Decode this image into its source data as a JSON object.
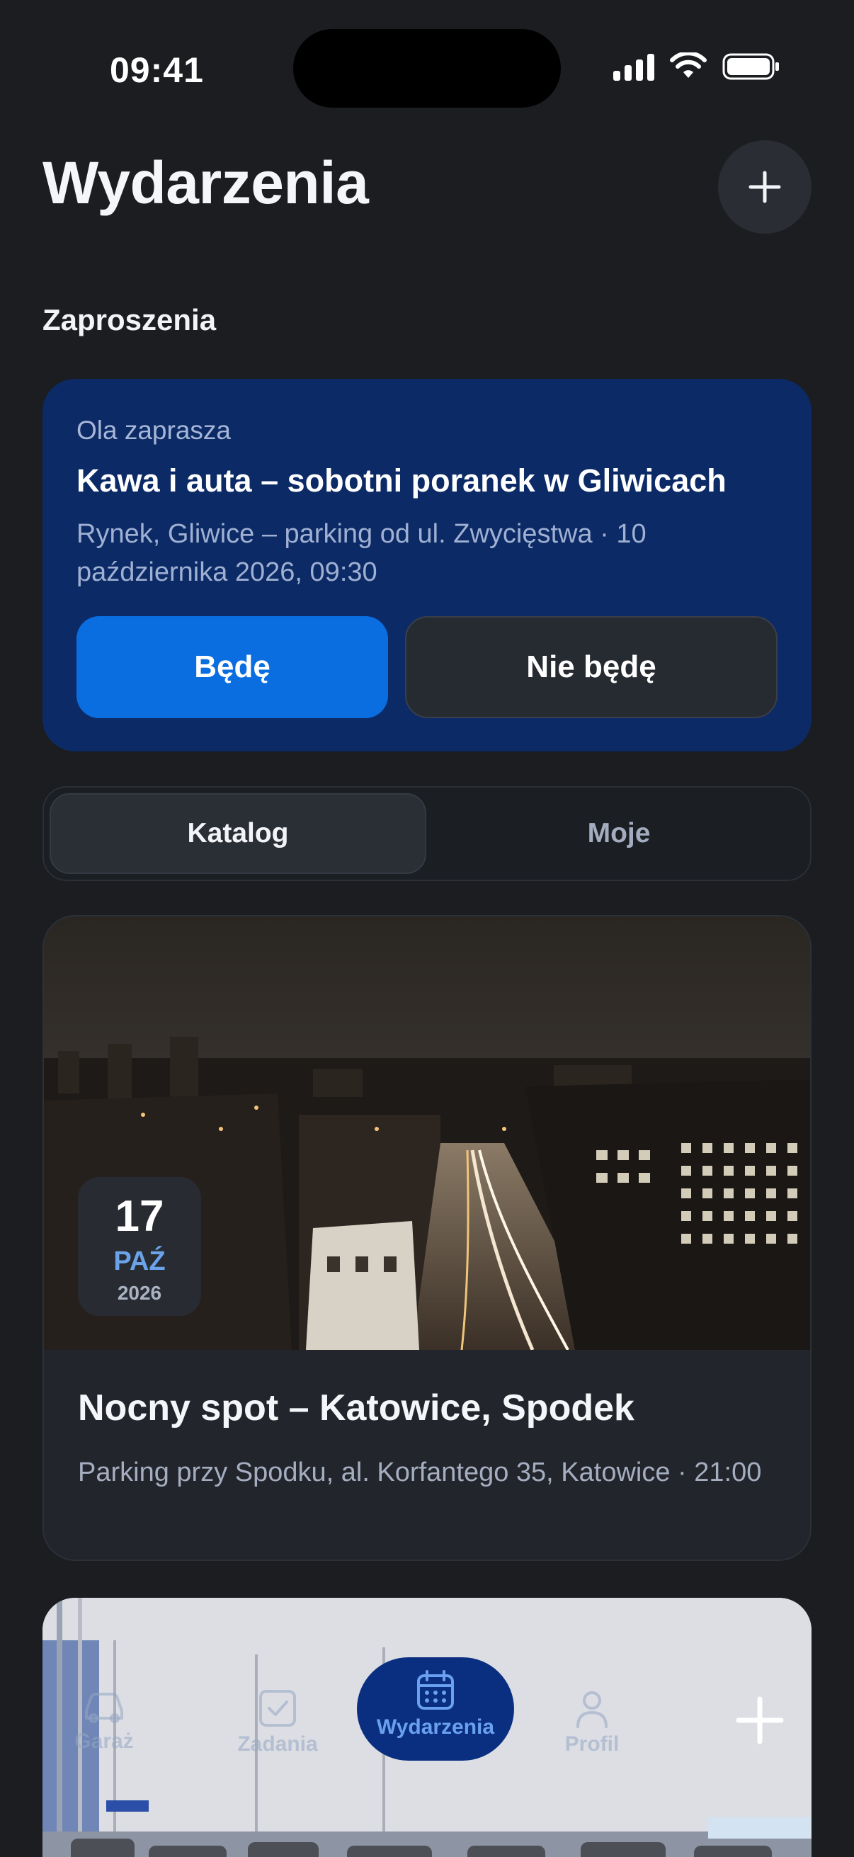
{
  "status_bar": {
    "time": "09:41"
  },
  "header": {
    "title": "Wydarzenia"
  },
  "invitations": {
    "section_title": "Zaproszenia",
    "card": {
      "from": "Ola zaprasza",
      "title": "Kawa i auta – sobotni poranek w Gliwicach",
      "meta": "Rynek, Gliwice – parking od ul. Zwycięstwa · 10 października 2026, 09:30",
      "accept_label": "Będę",
      "decline_label": "Nie będę"
    }
  },
  "segment": {
    "tabs": [
      "Katalog",
      "Moje"
    ],
    "selected": "Katalog"
  },
  "events": [
    {
      "day": "17",
      "month": "PAŹ",
      "year": "2026",
      "title": "Nocny spot – Katowice, Spodek",
      "meta": "Parking przy Spodku, al. Korfantego 35, Katowice · 21:00"
    }
  ],
  "tabbar": {
    "items": [
      {
        "label": "Garaż",
        "icon": "car-icon"
      },
      {
        "label": "Zadania",
        "icon": "checkbox-icon"
      },
      {
        "label": "Wydarzenia",
        "icon": "calendar-icon",
        "active": true
      },
      {
        "label": "Profil",
        "icon": "person-icon"
      }
    ],
    "plus_icon": "plus-icon"
  },
  "colors": {
    "background": "#1b1d21",
    "invite_card": "#0c2a66",
    "accent": "#0a6ee0",
    "active_tab": "#0b2f80"
  }
}
